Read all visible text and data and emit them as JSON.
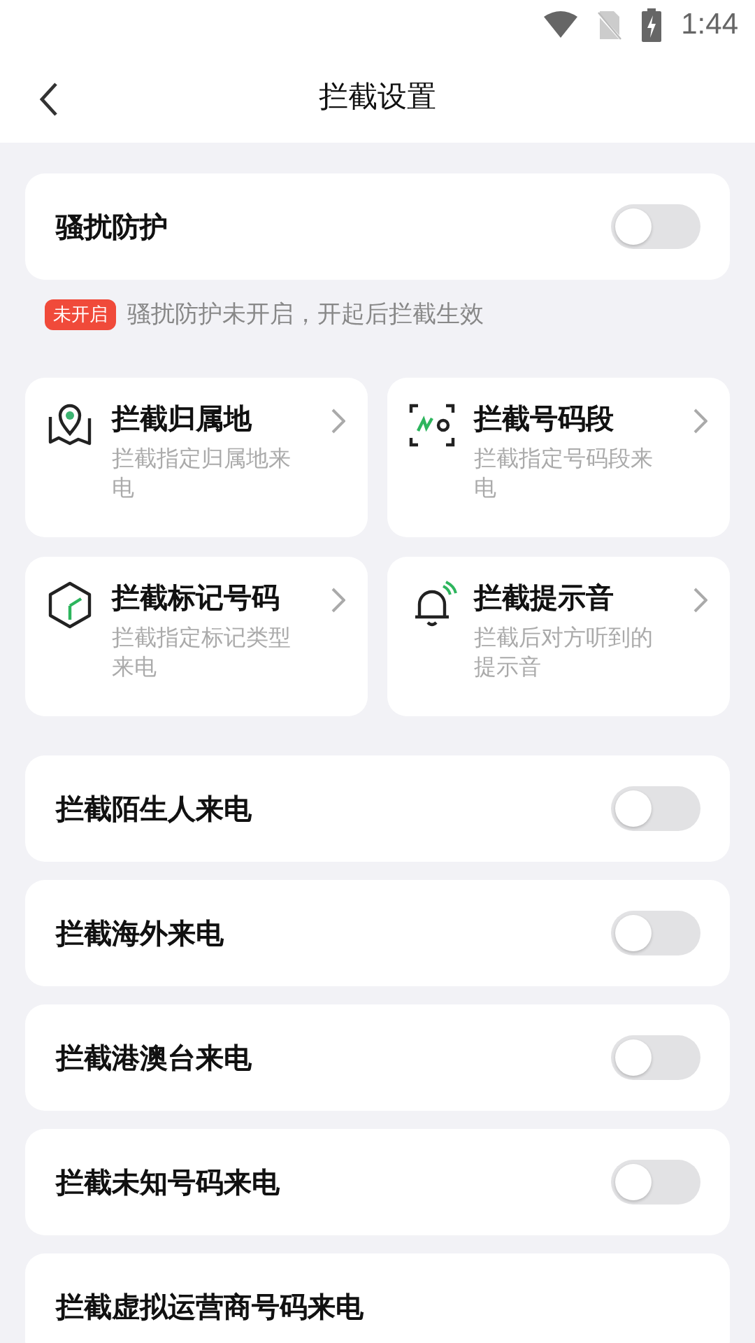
{
  "status_bar": {
    "time": "1:44"
  },
  "header": {
    "title": "拦截设置"
  },
  "protection": {
    "label": "骚扰防护",
    "on": false
  },
  "notice": {
    "badge": "未开启",
    "text": "骚扰防护未开启，开起后拦截生效"
  },
  "shortcuts": [
    {
      "kind": "map",
      "title": "拦截归属地",
      "subtitle": "拦截指定归属地来电"
    },
    {
      "kind": "number",
      "title": "拦截号码段",
      "subtitle": "拦截指定号码段来电"
    },
    {
      "kind": "cube",
      "title": "拦截标记号码",
      "subtitle": "拦截指定标记类型来电"
    },
    {
      "kind": "bell",
      "title": "拦截提示音",
      "subtitle": "拦截后对方听到的提示音"
    }
  ],
  "switches": [
    {
      "label": "拦截陌生人来电",
      "on": false
    },
    {
      "label": "拦截海外来电",
      "on": false
    },
    {
      "label": "拦截港澳台来电",
      "on": false
    },
    {
      "label": "拦截未知号码来电",
      "on": false
    },
    {
      "label": "拦截虚拟运营商号码来电"
    }
  ]
}
